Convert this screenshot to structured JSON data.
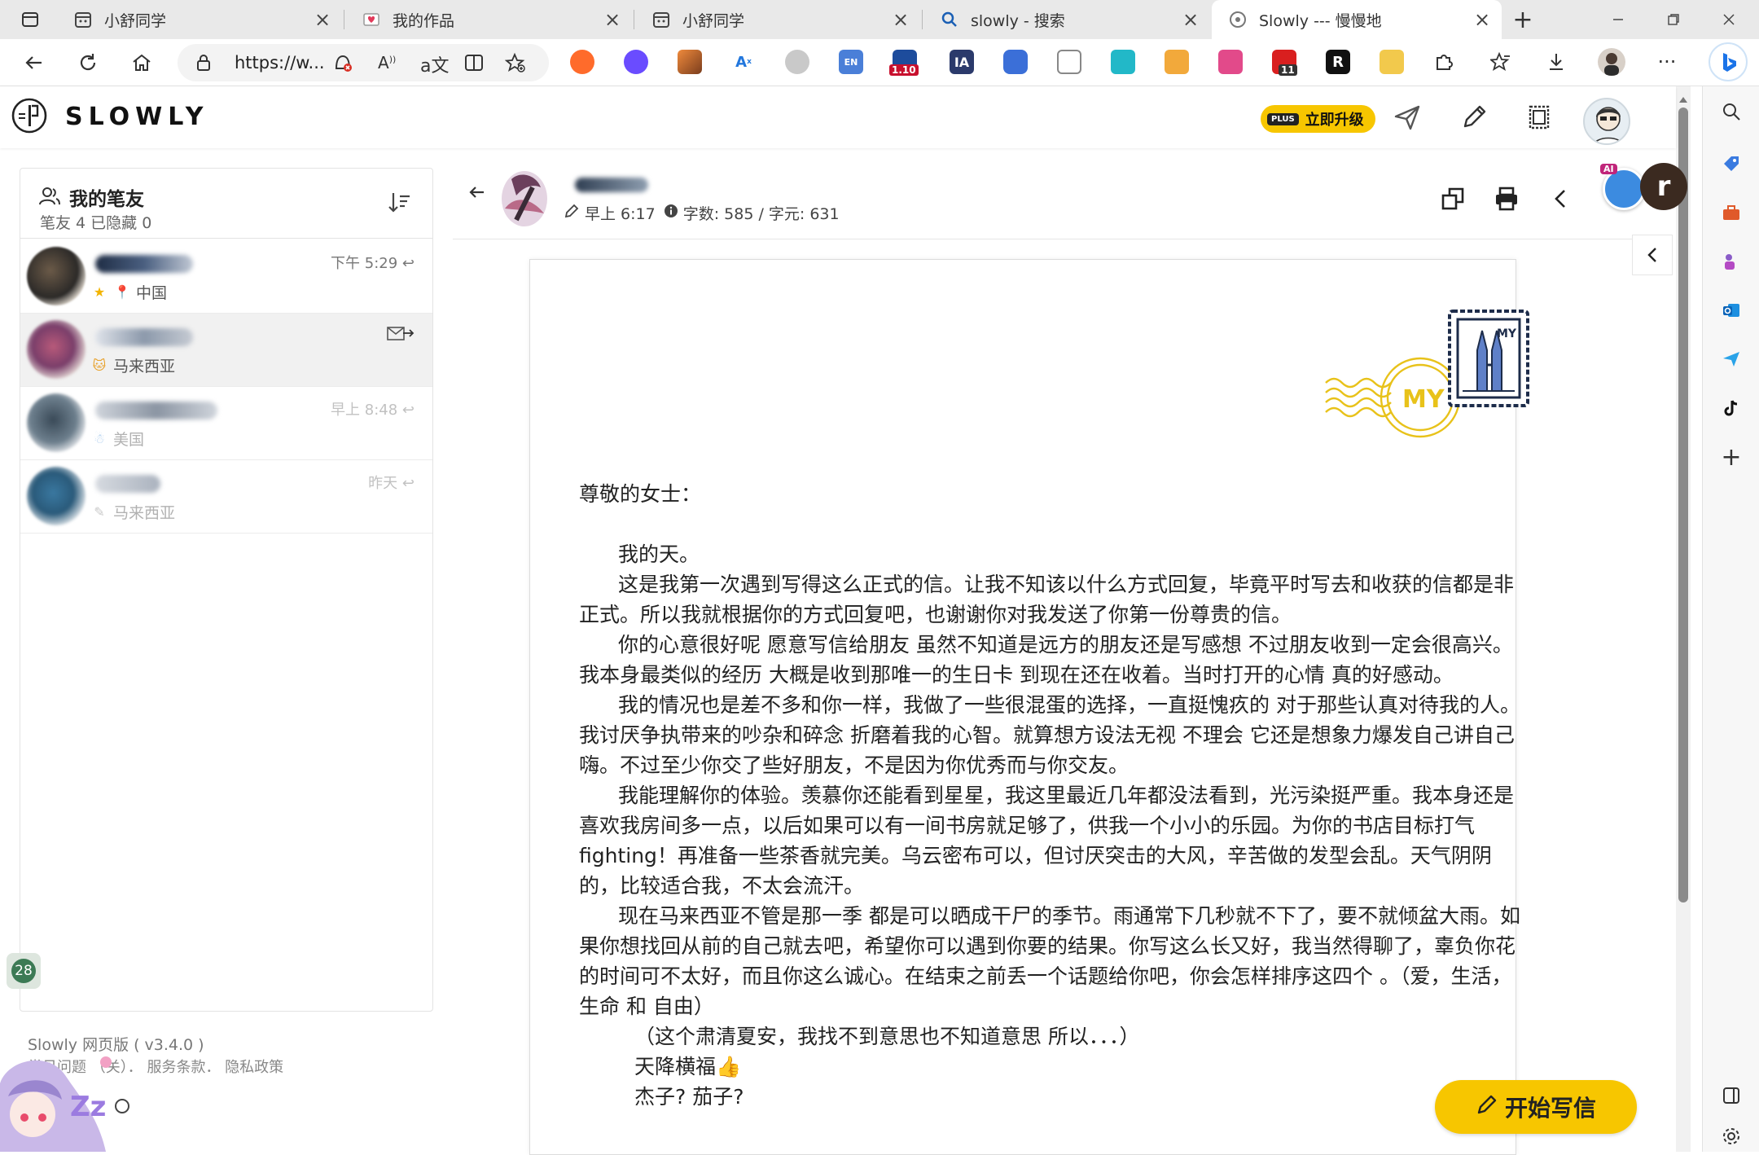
{
  "browser": {
    "tabs": [
      {
        "title": "小舒同学",
        "icon": "calendar-icon"
      },
      {
        "title": "我的作品",
        "icon": "envelope-heart-icon"
      },
      {
        "title": "小舒同学",
        "icon": "calendar-icon"
      },
      {
        "title": "slowly - 搜索",
        "icon": "search-icon"
      },
      {
        "title": "Slowly --- 慢慢地",
        "icon": "slowly-icon",
        "active": true
      }
    ],
    "url": "https://w...",
    "ext_badges": {
      "badge_a": "1.10",
      "badge_b": "11"
    },
    "ext_labels": {
      "ia": "IA",
      "r": "R",
      "en": "EN"
    }
  },
  "app": {
    "name": "SLOWLY",
    "upgrade_badge": "PLUS",
    "upgrade_label": "立即升级"
  },
  "friends": {
    "title": "我的笔友",
    "subtitle": "笔友 4  已隐藏 0",
    "items": [
      {
        "time": "下午 5:29",
        "location": "中国",
        "faded": false
      },
      {
        "time": "",
        "location": "马来西亚",
        "faded": false,
        "selected": true
      },
      {
        "time": "早上 8:48",
        "location": "美国",
        "faded": true
      },
      {
        "time": "昨天",
        "location": "马来西亚",
        "faded": true
      }
    ],
    "badge_count": "28"
  },
  "footer": {
    "version": "Slowly 网页版 ( v3.4.0 )",
    "links": "常见问题 （关）．  服务条款．  隐私政策"
  },
  "letter": {
    "time": "早上 6:17",
    "word_count": "字数: 585 / 字元: 631",
    "stamp_code": "MY",
    "greeting": "尊敬的女士：",
    "paragraphs": [
      "我的天。",
      "这是我第一次遇到写得这么正式的信。让我不知该以什么方式回复，毕竟平时写去和收获的信都是非正式。所以我就根据你的方式回复吧，也谢谢你对我发送了你第一份尊贵的信。",
      "你的心意很好呢 愿意写信给朋友 虽然不知道是远方的朋友还是写感想 不过朋友收到一定会很高兴。 我本身最类似的经历 大概是收到那唯一的生日卡 到现在还在收着。当时打开的心情 真的好感动。",
      "我的情况也是差不多和你一样，我做了一些很混蛋的选择，一直挺愧疚的 对于那些认真对待我的人。我讨厌争执带来的吵杂和碎念 折磨着我的心智。就算想方设法无视 不理会 它还是想象力爆发自己讲自己嗨。不过至少你交了些好朋友，不是因为你优秀而与你交友。",
      "我能理解你的体验。羡慕你还能看到星星，我这里最近几年都没法看到，光污染挺严重。我本身还是喜欢我房间多一点，以后如果可以有一间书房就足够了，供我一个小小的乐园。为你的书店目标打气 fighting！再准备一些茶香就完美。乌云密布可以，但讨厌突击的大风，辛苦做的发型会乱。天气阴阴的，比较适合我，不太会流汗。",
      "现在马来西亚不管是那一季 都是可以晒成干尸的季节。雨通常下几秒就不下了，要不就倾盆大雨。如果你想找回从前的自己就去吧，希望你可以遇到你要的结果。你写这么长又好，我当然得聊了，辜负你花的时间可不太好，而且你这么诚心。在结束之前丢一个话题给你吧，你会怎样排序这四个 。（爱，生活，生命 和 自由）"
    ],
    "postscripts": [
      "（这个肃清夏安，我找不到意思也不知道意思 所以．．．）",
      "天降横福👍",
      "杰子? 茄子?"
    ]
  },
  "actions": {
    "write_label": "开始写信"
  },
  "colors": {
    "accent": "#f7c600",
    "stamp_navy": "#1d2c4a",
    "postmark": "#e8c21a"
  }
}
